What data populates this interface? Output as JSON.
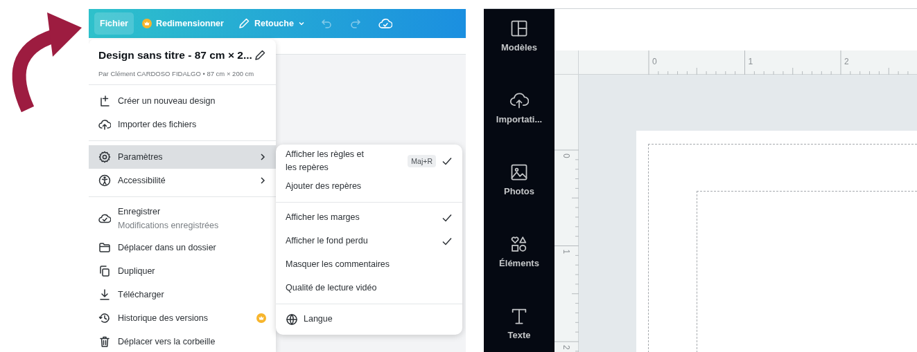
{
  "menu_screenshot": {
    "toolbar": [
      {
        "kind": "text",
        "label": "Fichier",
        "selected": true
      },
      {
        "kind": "premium",
        "label": "Redimensionner",
        "selected": false
      },
      {
        "kind": "dropdown",
        "label": "Retouche",
        "selected": false
      },
      {
        "kind": "undo",
        "disabled": true
      },
      {
        "kind": "redo",
        "disabled": true
      },
      {
        "kind": "saved",
        "disabled": false
      }
    ],
    "file_menu": {
      "title": "Design sans titre - 87 cm × 2...",
      "subtitle": "Par Clément CARDOSO FIDALGO • 87 cm × 200 cm",
      "sections": [
        [
          {
            "label": "Créer un nouveau design",
            "selected": false
          },
          {
            "label": "Importer des fichiers",
            "selected": false
          }
        ],
        [
          {
            "label": "Paramètres",
            "selected": true,
            "submenu": true
          },
          {
            "label": "Accessibilité",
            "selected": false,
            "submenu": true
          }
        ],
        [
          {
            "label": "Enregistrer",
            "sublabel": "Modifications enregistrées",
            "selected": false
          },
          {
            "label": "Déplacer dans un dossier",
            "selected": false
          },
          {
            "label": "Dupliquer",
            "selected": false
          },
          {
            "label": "Télécharger",
            "selected": false
          },
          {
            "label": "Historique des versions",
            "selected": false,
            "premium": true
          },
          {
            "label": "Déplacer vers la corbeille",
            "selected": false
          }
        ]
      ]
    },
    "settings_submenu": {
      "sections": [
        [
          {
            "label": "Afficher les règles et les repères",
            "shortcut": "Maj+R",
            "checked": true
          },
          {
            "label": "Ajouter des repères",
            "checked": false
          }
        ],
        [
          {
            "label": "Afficher les marges",
            "checked": true
          },
          {
            "label": "Afficher le fond perdu",
            "checked": true
          },
          {
            "label": "Masquer les commentaires",
            "checked": false
          },
          {
            "label": "Qualité de lecture vidéo",
            "checked": false
          }
        ],
        [
          {
            "label": "Langue",
            "kind": "language",
            "checked": false
          }
        ]
      ]
    }
  },
  "editor_screenshot": {
    "sidebar": [
      {
        "label": "Modèles"
      },
      {
        "label": "Importati..."
      },
      {
        "label": "Photos"
      },
      {
        "label": "Éléments"
      },
      {
        "label": "Texte"
      }
    ],
    "horizontal_ruler": [
      "0",
      "1",
      "2"
    ],
    "vertical_ruler": [
      "0",
      "1",
      "2"
    ]
  }
}
